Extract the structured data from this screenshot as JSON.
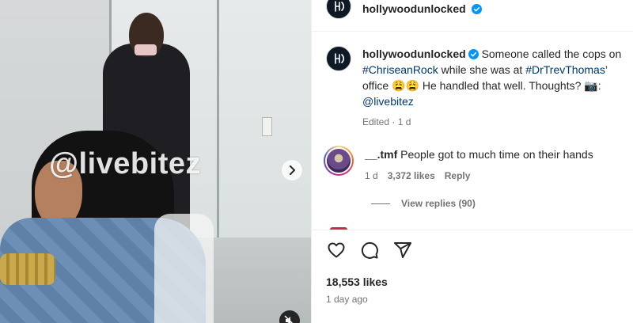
{
  "media": {
    "watermark": "@livebitez",
    "next_icon": "chevron-right-icon",
    "mute_icon": "speaker-muted-icon"
  },
  "post": {
    "author": "hollywoodunlocked",
    "verified": true,
    "caption": {
      "author": "hollywoodunlocked",
      "part1": "Someone called the cops on ",
      "tag1": "#ChriseanRock",
      "part2": " while she was at ",
      "tag2": "#DrTrevThomas",
      "part3": "’ office 😩😩 He handled that well. Thoughts? 📷: ",
      "mention": "@livebitez",
      "edited": "Edited",
      "separator": "·",
      "age": "1 d"
    },
    "comment": {
      "user": "__.tmf",
      "text": "People got to much time on their hands",
      "age": "1 d",
      "likes": "3,372 likes",
      "reply": "Reply",
      "view_replies": "View replies (90)"
    },
    "likes_count": "18,553 likes",
    "posted": "1 day ago"
  },
  "colors": {
    "link": "#00376b",
    "muted": "#737373",
    "verified": "#0095f6"
  }
}
